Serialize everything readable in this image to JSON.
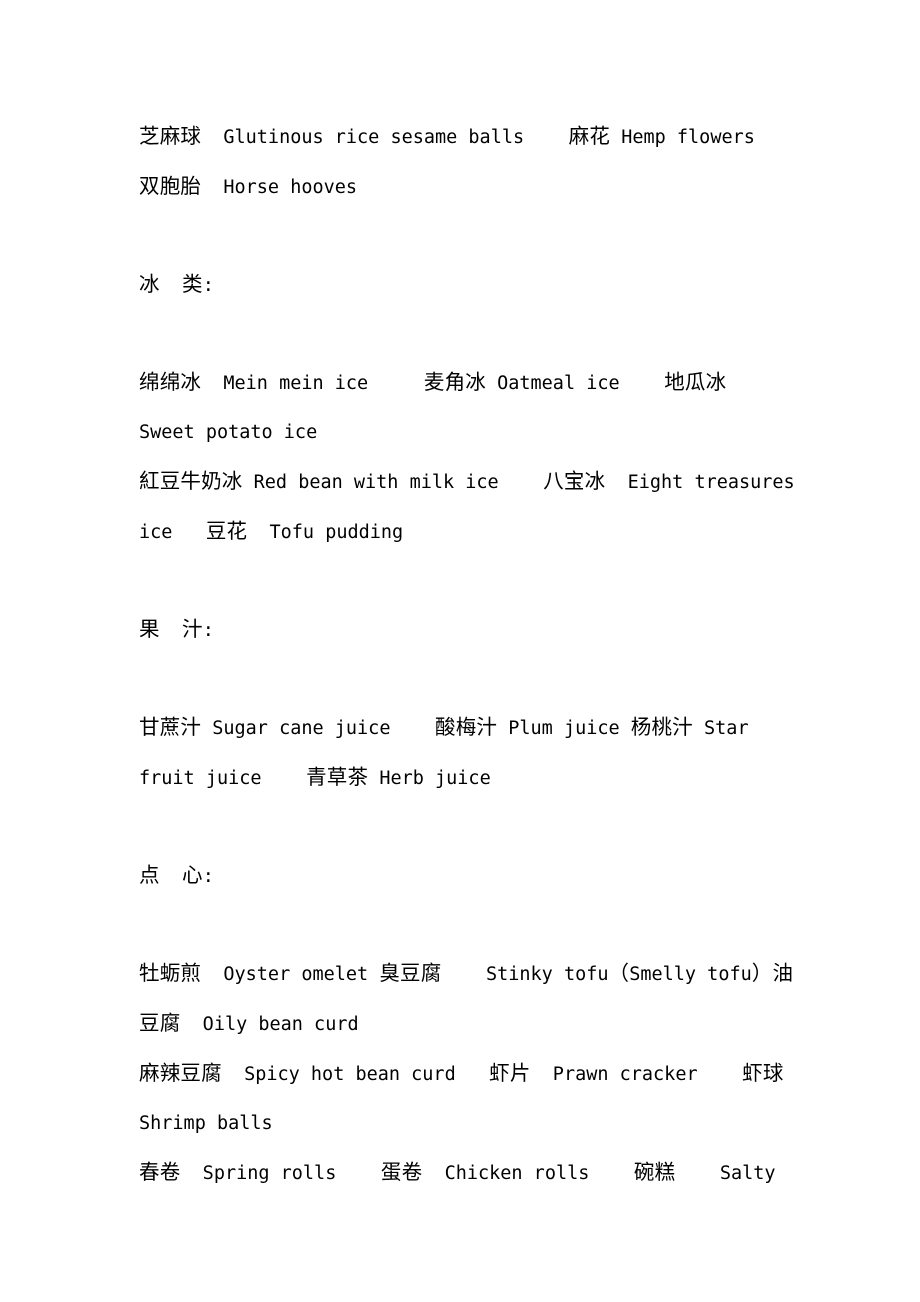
{
  "document": {
    "type": "bilingual-food-glossary",
    "language_pair": "Chinese-English",
    "page_background": "#ffffff",
    "text_color": "#000000"
  },
  "blocks": [
    {
      "id": "snacks-continued",
      "kind": "entry-group",
      "lines": [
        "芝麻球  Glutinous rice sesame balls    麻花 Hemp flowers",
        "双胞胎  Horse hooves"
      ]
    },
    {
      "id": "ice-heading",
      "kind": "heading",
      "text": "冰  类:"
    },
    {
      "id": "ice-entries-1",
      "kind": "entry-group",
      "lines": [
        "绵绵冰  Mein mein ice     麦角冰 Oatmeal ice    地瓜冰  Sweet potato ice"
      ]
    },
    {
      "id": "ice-entries-2",
      "kind": "entry-group",
      "lines": [
        "紅豆牛奶冰 Red bean with milk ice    八宝冰  Eight treasures ice   豆花  Tofu pudding"
      ]
    },
    {
      "id": "juice-heading",
      "kind": "heading",
      "text": "果  汁:"
    },
    {
      "id": "juice-entries",
      "kind": "entry-group",
      "lines": [
        "甘蔗汁 Sugar cane juice    酸梅汁 Plum juice 杨桃汁 Star fruit juice    青草茶 Herb juice"
      ]
    },
    {
      "id": "dimsum-heading",
      "kind": "heading",
      "text": "点  心:"
    },
    {
      "id": "dimsum-entries-1",
      "kind": "entry-group",
      "lines": [
        "牡蛎煎  Oyster omelet 臭豆腐    Stinky tofu（Smelly tofu）油豆腐  Oily bean curd"
      ]
    },
    {
      "id": "dimsum-entries-2",
      "kind": "entry-group",
      "lines": [
        "麻辣豆腐  Spicy hot bean curd   虾片  Prawn cracker    虾球 Shrimp balls"
      ]
    },
    {
      "id": "dimsum-entries-3",
      "kind": "entry-group",
      "lines": [
        "春卷  Spring rolls    蛋卷  Chicken rolls    碗糕    Salty"
      ]
    }
  ],
  "entries": [
    {
      "zh": "芝麻球",
      "en": "Glutinous rice sesame balls",
      "section": "snacks"
    },
    {
      "zh": "麻花",
      "en": "Hemp flowers",
      "section": "snacks"
    },
    {
      "zh": "双胞胎",
      "en": "Horse hooves",
      "section": "snacks"
    },
    {
      "zh": "绵绵冰",
      "en": "Mein mein ice",
      "section": "ice"
    },
    {
      "zh": "麦角冰",
      "en": "Oatmeal ice",
      "section": "ice"
    },
    {
      "zh": "地瓜冰",
      "en": "Sweet potato ice",
      "section": "ice"
    },
    {
      "zh": "紅豆牛奶冰",
      "en": "Red bean with milk ice",
      "section": "ice"
    },
    {
      "zh": "八宝冰",
      "en": "Eight treasures ice",
      "section": "ice"
    },
    {
      "zh": "豆花",
      "en": "Tofu pudding",
      "section": "ice"
    },
    {
      "zh": "甘蔗汁",
      "en": "Sugar cane juice",
      "section": "juice"
    },
    {
      "zh": "酸梅汁",
      "en": "Plum juice",
      "section": "juice"
    },
    {
      "zh": "杨桃汁",
      "en": "Star fruit juice",
      "section": "juice"
    },
    {
      "zh": "青草茶",
      "en": "Herb juice",
      "section": "juice"
    },
    {
      "zh": "牡蛎煎",
      "en": "Oyster omelet",
      "section": "dimsum"
    },
    {
      "zh": "臭豆腐",
      "en": "Stinky tofu（Smelly tofu）",
      "section": "dimsum"
    },
    {
      "zh": "油豆腐",
      "en": "Oily bean curd",
      "section": "dimsum"
    },
    {
      "zh": "麻辣豆腐",
      "en": "Spicy hot bean curd",
      "section": "dimsum"
    },
    {
      "zh": "虾片",
      "en": "Prawn cracker",
      "section": "dimsum"
    },
    {
      "zh": "虾球",
      "en": "Shrimp balls",
      "section": "dimsum"
    },
    {
      "zh": "春卷",
      "en": "Spring rolls",
      "section": "dimsum"
    },
    {
      "zh": "蛋卷",
      "en": "Chicken rolls",
      "section": "dimsum"
    },
    {
      "zh": "碗糕",
      "en": "Salty",
      "section": "dimsum"
    }
  ]
}
